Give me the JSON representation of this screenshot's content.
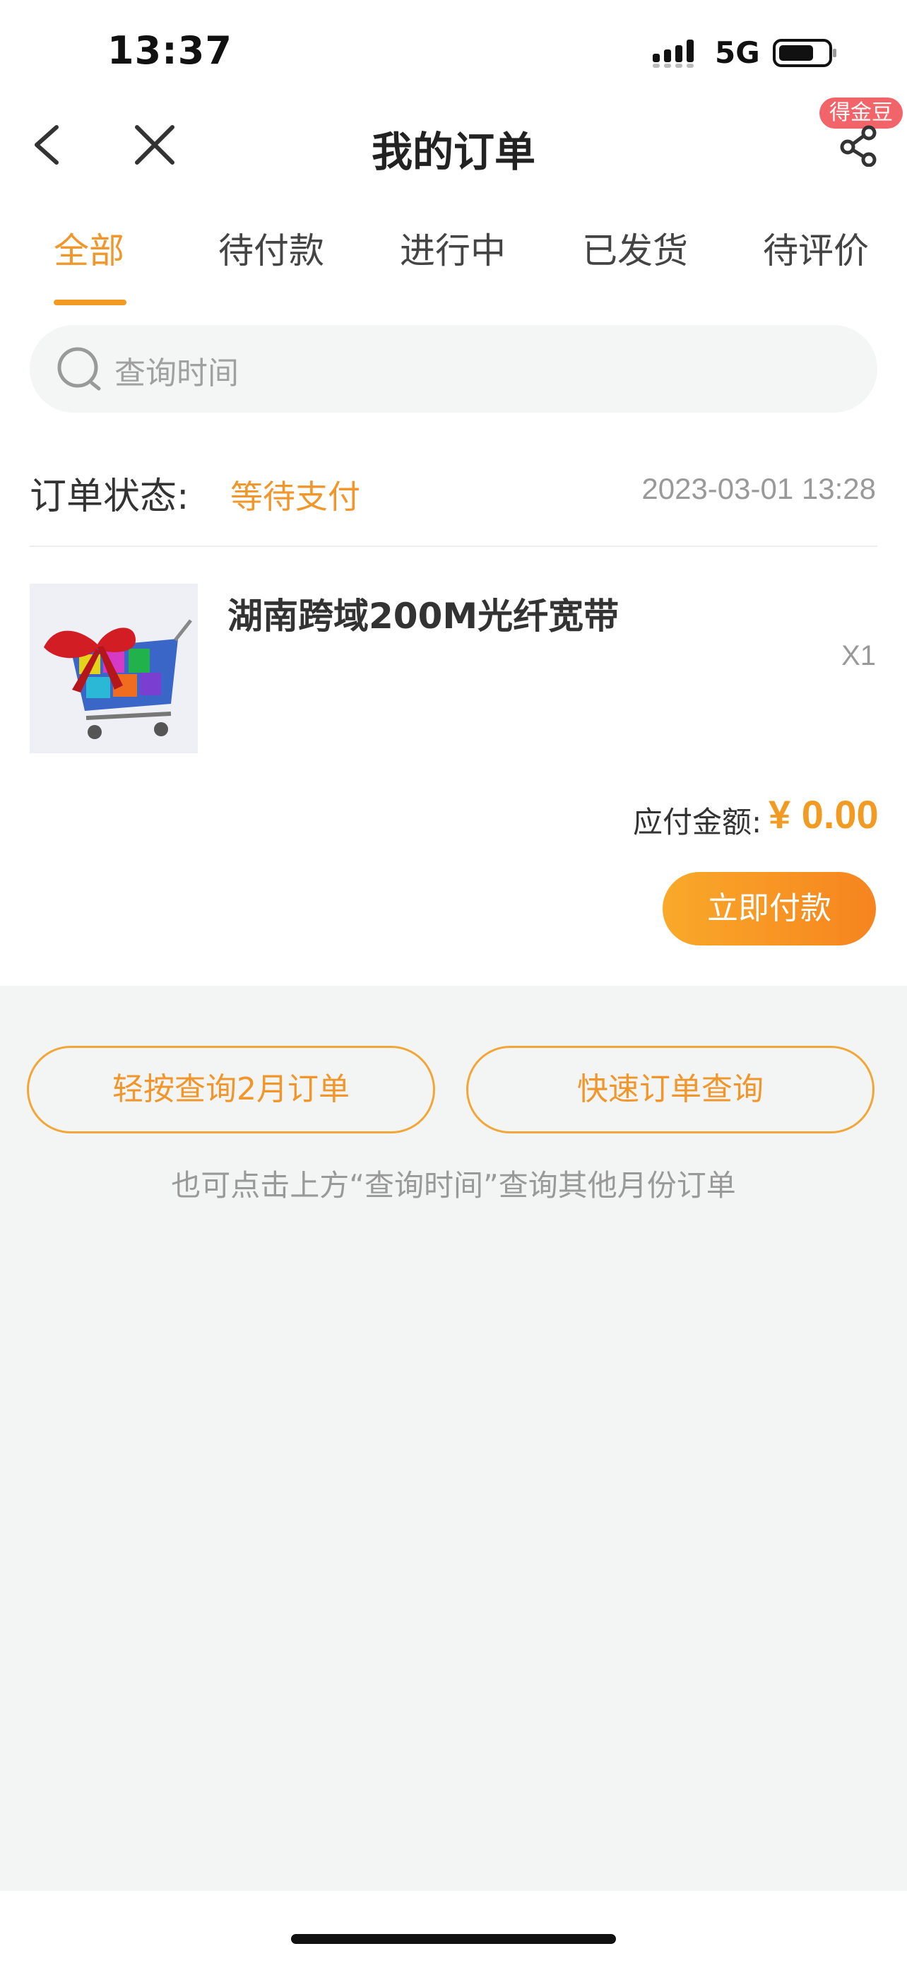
{
  "status_bar": {
    "time": "13:37",
    "network": "5G"
  },
  "nav": {
    "title": "我的订单",
    "badge": "得金豆"
  },
  "tabs": [
    {
      "label": "全部",
      "active": true
    },
    {
      "label": "待付款",
      "active": false
    },
    {
      "label": "进行中",
      "active": false
    },
    {
      "label": "已发货",
      "active": false
    },
    {
      "label": "待评价",
      "active": false
    }
  ],
  "search": {
    "placeholder": "查询时间"
  },
  "order": {
    "status_label": "订单状态:",
    "status_value": "等待支付",
    "date": "2023-03-01 13:28",
    "product_name": "湖南跨域200M光纤宽带",
    "quantity": "X1",
    "amount_label": "应付金额:",
    "amount_value": "¥ 0.00",
    "pay_button": "立即付款"
  },
  "actions": {
    "query_month_button": "轻按查询2月订单",
    "quick_query_button": "快速订单查询",
    "hint": "也可点击上方“查询时间”查询其他月份订单"
  },
  "colors": {
    "accent": "#f0962a",
    "badge": "#f1646a",
    "page_bg": "#f3f4f4"
  }
}
